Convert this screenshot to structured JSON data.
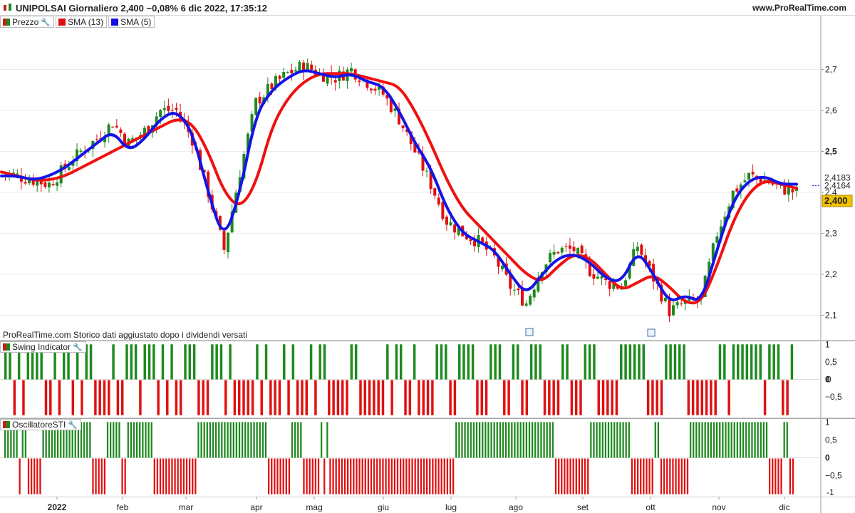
{
  "header": {
    "title": "UNIPOLSAI Giornaliero 2,400 −0,08% 6 dic 2022, 17:35:12",
    "site": "www.ProRealTime.com"
  },
  "legend": [
    {
      "label": "Prezzo",
      "color": "#1e8a1e"
    },
    {
      "label": "SMA (13)",
      "color": "#e01010"
    },
    {
      "label": "SMA (5)",
      "color": "#1010e0"
    }
  ],
  "disclaimer": "ProRealTime.com  Storico dati aggiustato dopo i dividendi versati",
  "panels": {
    "swing_label": "Swing Indicator",
    "oscillator_label": "OscillatoreSTI"
  },
  "badges": {
    "sma13": "2,4183",
    "sma5": "2,4164",
    "last": "2,400",
    "swing_last": "0",
    "osc_last": "-1"
  },
  "colors": {
    "up": "#1e8a1e",
    "down": "#e01010",
    "sma13": "#f01010",
    "sma5": "#1414e6",
    "last_badge": "#f2c200"
  },
  "chart_data": [
    {
      "type": "candlestick",
      "title": "UNIPOLSAI Giornaliero",
      "xlabel": "",
      "ylabel": "",
      "x_ticks": [
        "2022",
        "feb",
        "mar",
        "apr",
        "mag",
        "giu",
        "lug",
        "ago",
        "set",
        "ott",
        "nov",
        "dic"
      ],
      "y_ticks": [
        "2,1",
        "2,2",
        "2,3",
        "2,4",
        "2,5",
        "2,6",
        "2,7"
      ],
      "ylim": [
        2.04,
        2.8
      ],
      "grid": true,
      "series": [
        {
          "name": "SMA (13)",
          "values": [
            2.45,
            2.44,
            2.43,
            2.43,
            2.44,
            2.46,
            2.48,
            2.5,
            2.52,
            2.54,
            2.56,
            2.58,
            2.57,
            2.5,
            2.4,
            2.36,
            2.42,
            2.56,
            2.63,
            2.67,
            2.69,
            2.69,
            2.69,
            2.68,
            2.67,
            2.66,
            2.6,
            2.52,
            2.43,
            2.36,
            2.32,
            2.28,
            2.24,
            2.2,
            2.18,
            2.22,
            2.25,
            2.24,
            2.2,
            2.16,
            2.18,
            2.2,
            2.17,
            2.13,
            2.13,
            2.22,
            2.33,
            2.4,
            2.43,
            2.42,
            2.41
          ]
        },
        {
          "name": "SMA (5)",
          "values": [
            2.44,
            2.44,
            2.43,
            2.44,
            2.46,
            2.49,
            2.52,
            2.55,
            2.5,
            2.53,
            2.58,
            2.6,
            2.55,
            2.4,
            2.28,
            2.4,
            2.59,
            2.65,
            2.68,
            2.7,
            2.69,
            2.68,
            2.69,
            2.67,
            2.66,
            2.6,
            2.52,
            2.46,
            2.36,
            2.3,
            2.28,
            2.26,
            2.2,
            2.15,
            2.2,
            2.24,
            2.25,
            2.23,
            2.19,
            2.18,
            2.26,
            2.2,
            2.13,
            2.15,
            2.13,
            2.26,
            2.38,
            2.43,
            2.44,
            2.42,
            2.42
          ]
        },
        {
          "name": "Prezzo",
          "values": [
            2.45,
            2.44,
            2.43,
            2.42,
            2.46,
            2.5,
            2.53,
            2.57,
            2.52,
            2.55,
            2.6,
            2.6,
            2.53,
            2.4,
            2.26,
            2.45,
            2.62,
            2.66,
            2.69,
            2.71,
            2.69,
            2.68,
            2.7,
            2.67,
            2.64,
            2.58,
            2.5,
            2.42,
            2.33,
            2.3,
            2.28,
            2.24,
            2.17,
            2.13,
            2.22,
            2.26,
            2.26,
            2.21,
            2.18,
            2.17,
            2.27,
            2.19,
            2.11,
            2.13,
            2.14,
            2.3,
            2.4,
            2.44,
            2.43,
            2.41,
            2.4
          ]
        }
      ]
    },
    {
      "type": "bar",
      "title": "Swing Indicator",
      "ylim": [
        -1,
        1
      ],
      "y_ticks": [
        "1",
        "0,5",
        "0",
        "−0,5"
      ],
      "values": [
        1,
        1,
        -1,
        1,
        -1,
        1,
        1,
        1,
        1,
        -1,
        -1,
        1,
        -1,
        1,
        1,
        -1,
        1,
        -1,
        1,
        1,
        -1,
        -1,
        -1,
        -1,
        1,
        -1,
        -1,
        1,
        1,
        1,
        -1,
        1,
        1,
        1,
        -1,
        1,
        -1,
        1,
        -1,
        -1,
        1,
        1,
        1,
        -1,
        -1,
        -1,
        1,
        1,
        1,
        -1,
        1,
        -1,
        -1,
        -1,
        -1,
        -1,
        1,
        -1,
        1,
        -1,
        -1,
        -1,
        1,
        -1,
        1,
        -1,
        -1,
        -1,
        1,
        -1,
        1,
        1,
        -1,
        -1,
        -1,
        -1,
        -1,
        1,
        1,
        -1,
        -1,
        -1,
        -1,
        -1,
        -1,
        1,
        -1,
        1,
        1,
        -1,
        -1,
        1,
        -1,
        -1,
        -1,
        -1,
        1,
        1,
        1,
        -1,
        -1,
        1,
        1,
        1,
        1,
        -1,
        -1,
        -1,
        1,
        1,
        1,
        -1,
        -1,
        1,
        1,
        -1,
        -1,
        1,
        1,
        1,
        -1,
        -1,
        -1,
        -1,
        1,
        1,
        -1,
        -1,
        -1,
        1,
        1,
        1,
        -1,
        -1,
        -1,
        -1,
        -1,
        1,
        1,
        1,
        1,
        1,
        1,
        -1,
        -1,
        -1,
        -1,
        1,
        1,
        1,
        1,
        1,
        -1,
        -1,
        -1,
        -1,
        -1,
        -1,
        -1,
        1,
        1,
        -1,
        1,
        1,
        1,
        1,
        1,
        1,
        1,
        -1,
        1,
        1,
        1,
        -1,
        -1,
        1
      ]
    },
    {
      "type": "bar",
      "title": "OscillatoreSTI",
      "ylim": [
        -1,
        1
      ],
      "y_ticks": [
        "1",
        "0,5",
        "0",
        "−0,5"
      ],
      "values": [
        1,
        1,
        1,
        1,
        1,
        -1,
        1,
        1,
        -1,
        -1,
        -1,
        -1,
        -1,
        1,
        1,
        1,
        1,
        1,
        1,
        1,
        1,
        1,
        1,
        1,
        1,
        1,
        1,
        1,
        1,
        1,
        -1,
        -1,
        -1,
        -1,
        -1,
        1,
        1,
        1,
        1,
        1,
        -1,
        -1,
        1,
        1,
        1,
        1,
        1,
        1,
        1,
        1,
        1,
        -1,
        -1,
        -1,
        -1,
        -1,
        -1,
        -1,
        -1,
        -1,
        -1,
        -1,
        -1,
        -1,
        -1,
        -1,
        1,
        1,
        1,
        1,
        1,
        1,
        1,
        1,
        1,
        1,
        1,
        1,
        1,
        1,
        1,
        1,
        1,
        1,
        1,
        1,
        1,
        1,
        1,
        1,
        -1,
        -1,
        -1,
        -1,
        -1,
        -1,
        -1,
        -1,
        1,
        1,
        1,
        1,
        -1,
        -1,
        -1,
        -1,
        -1,
        -1,
        1,
        -1,
        1,
        -1,
        -1,
        -1,
        -1,
        -1,
        -1,
        -1,
        -1,
        -1,
        -1,
        -1,
        -1,
        -1,
        -1,
        -1,
        -1,
        -1,
        -1,
        -1,
        -1,
        -1,
        -1,
        -1,
        -1,
        -1,
        -1,
        -1,
        -1,
        -1,
        -1,
        -1,
        -1,
        -1,
        -1,
        -1,
        -1,
        -1,
        -1,
        -1,
        -1,
        -1,
        -1,
        -1,
        1,
        1,
        1,
        1,
        1,
        1,
        1,
        1,
        1,
        1,
        1,
        1,
        1,
        1,
        1,
        1,
        1,
        1,
        1,
        1,
        1,
        1,
        1,
        1,
        1,
        1,
        1,
        1,
        1,
        1,
        1,
        1,
        1,
        1,
        -1,
        -1,
        -1,
        -1,
        -1,
        -1,
        -1,
        -1,
        -1,
        -1,
        -1,
        -1,
        1,
        1,
        1,
        1,
        1,
        1,
        1,
        1,
        1,
        1,
        1,
        1,
        1,
        1,
        -1,
        -1,
        -1,
        -1,
        -1,
        -1,
        -1,
        -1,
        1,
        1,
        -1,
        -1,
        -1,
        -1,
        -1,
        -1,
        -1,
        -1,
        -1,
        -1,
        1,
        1,
        1,
        1,
        1,
        1,
        1,
        1,
        1,
        1,
        1,
        1,
        1,
        1,
        1,
        1,
        1,
        1,
        1,
        1,
        1,
        1,
        1,
        1,
        1,
        1,
        1,
        -1,
        -1,
        -1,
        -1,
        -1,
        1,
        1,
        -1,
        -1
      ]
    }
  ]
}
